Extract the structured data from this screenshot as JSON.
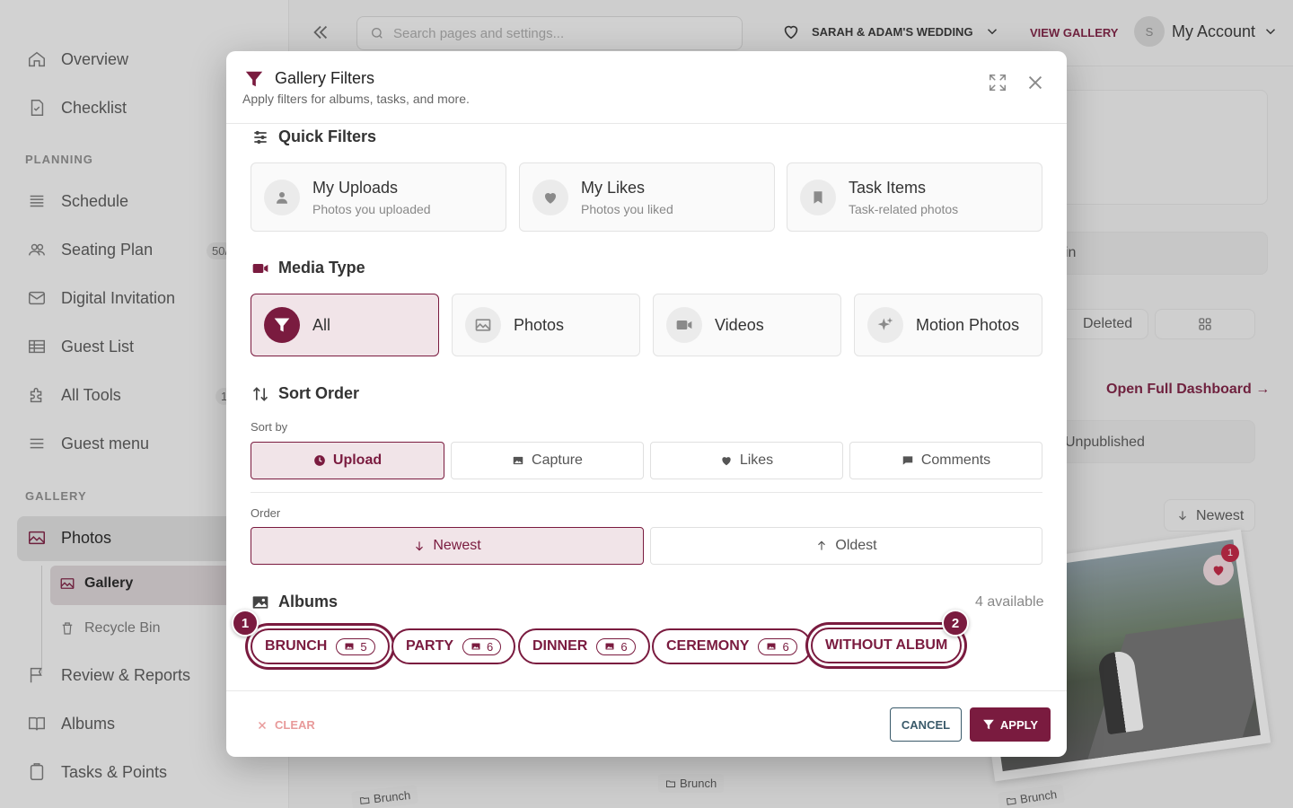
{
  "sidebar": {
    "items": [
      {
        "label": "Overview"
      },
      {
        "label": "Checklist"
      },
      {
        "label": "Schedule"
      },
      {
        "label": "Seating Plan",
        "count": "50/"
      },
      {
        "label": "Digital Invitation"
      },
      {
        "label": "Guest List"
      },
      {
        "label": "All Tools",
        "count": "1"
      },
      {
        "label": "Guest menu"
      },
      {
        "label": "Photos"
      },
      {
        "label": "Review & Reports"
      },
      {
        "label": "Albums"
      },
      {
        "label": "Tasks & Points"
      }
    ],
    "sections": {
      "planning": "PLANNING",
      "gallery": "GALLERY"
    },
    "sub_items": [
      {
        "label": "Gallery"
      },
      {
        "label": "Recycle Bin"
      }
    ]
  },
  "topbar": {
    "search_placeholder": "Search pages and settings...",
    "wedding_name": "SARAH & ADAM'S WEDDING",
    "view_gallery": "VIEW GALLERY",
    "account_label": "My Account",
    "avatar_initial": "S"
  },
  "background": {
    "partial_in": "in",
    "deleted": "Deleted",
    "open_dashboard": "Open Full Dashboard →",
    "unpublished": "Unpublished",
    "newest": "Newest",
    "like_count": "1",
    "album_tag": "Brunch"
  },
  "modal": {
    "title": "Gallery Filters",
    "subtitle": "Apply filters for albums, tasks, and more.",
    "quick_filters": {
      "title": "Quick Filters",
      "items": [
        {
          "title": "My Uploads",
          "subtitle": "Photos you uploaded",
          "icon": "user-icon"
        },
        {
          "title": "My Likes",
          "subtitle": "Photos you liked",
          "icon": "heart-icon"
        },
        {
          "title": "Task Items",
          "subtitle": "Task-related photos",
          "icon": "bookmark-icon"
        }
      ]
    },
    "media_type": {
      "title": "Media Type",
      "selected": "All",
      "options": [
        {
          "label": "All"
        },
        {
          "label": "Photos"
        },
        {
          "label": "Videos"
        },
        {
          "label": "Motion Photos"
        }
      ]
    },
    "sort_order": {
      "title": "Sort Order",
      "sort_by_label": "Sort by",
      "sort_by": [
        {
          "label": "Upload"
        },
        {
          "label": "Capture"
        },
        {
          "label": "Likes"
        },
        {
          "label": "Comments"
        }
      ],
      "selected_sort": "Upload",
      "order_label": "Order",
      "order": [
        {
          "label": "Newest"
        },
        {
          "label": "Oldest"
        }
      ],
      "selected_order": "Newest"
    },
    "albums": {
      "title": "Albums",
      "available": "4 available",
      "chips": [
        {
          "label": "BRUNCH",
          "count": "5"
        },
        {
          "label": "PARTY",
          "count": "6"
        },
        {
          "label": "DINNER",
          "count": "6"
        },
        {
          "label": "CEREMONY",
          "count": "6"
        },
        {
          "label": "WITHOUT ALBUM"
        }
      ],
      "markers": [
        "1",
        "2"
      ]
    },
    "footer": {
      "clear": "CLEAR",
      "cancel": "CANCEL",
      "apply": "APPLY"
    }
  },
  "colors": {
    "brand": "#7a1b3f",
    "selected_bg": "#f1e4e8",
    "cancel_border": "#3a5a6a"
  }
}
